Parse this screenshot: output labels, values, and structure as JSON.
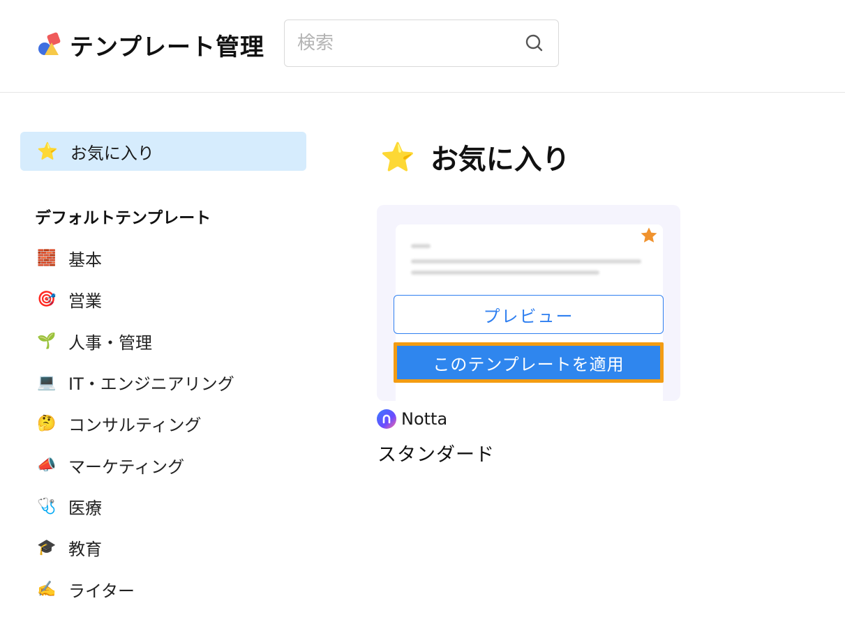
{
  "header": {
    "title": "テンプレート管理",
    "search_placeholder": "検索"
  },
  "sidebar": {
    "favorite": {
      "icon": "⭐",
      "label": "お気に入り"
    },
    "section_title": "デフォルトテンプレート",
    "categories": [
      {
        "icon": "🧱",
        "label": "基本"
      },
      {
        "icon": "🎯",
        "label": "営業"
      },
      {
        "icon": "🌱",
        "label": "人事・管理"
      },
      {
        "icon": "💻",
        "label": "IT・エンジニアリング"
      },
      {
        "icon": "🤔",
        "label": "コンサルティング"
      },
      {
        "icon": "📣",
        "label": "マーケティング"
      },
      {
        "icon": "🩺",
        "label": "医療"
      },
      {
        "icon": "🎓",
        "label": "教育"
      },
      {
        "icon": "✍️",
        "label": "ライター"
      }
    ]
  },
  "main": {
    "title_icon": "⭐",
    "title": "お気に入り",
    "card": {
      "preview_label": "プレビュー",
      "apply_label": "このテンプレートを適用",
      "author": "Notta",
      "name": "スタンダード"
    }
  },
  "colors": {
    "accent": "#2f86ee",
    "highlight_border": "#f39c12",
    "favorite_bg": "#d6ecfd",
    "star": "#f0922e"
  }
}
